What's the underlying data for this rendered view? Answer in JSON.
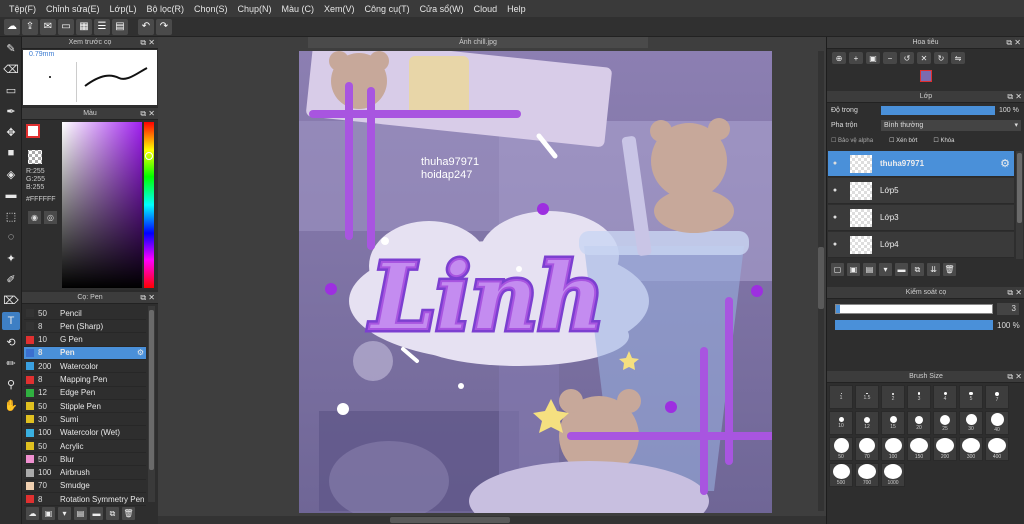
{
  "menu": [
    "Tệp(F)",
    "Chỉnh sửa(E)",
    "Lớp(L)",
    "Bộ lọc(R)",
    "Chọn(S)",
    "Chụp(N)",
    "Màu (C)",
    "Xem(V)",
    "Công cụ(T)",
    "Cửa sổ(W)",
    "Cloud",
    "Help"
  ],
  "brush_preview": {
    "title": "Xem trước cọ",
    "size": "0.79mm"
  },
  "color": {
    "title": "Màu",
    "r": "R:255",
    "g": "G:255",
    "b": "B:255",
    "hex": "#FFFFFF",
    "accent": "#a020f0"
  },
  "brush_panel": {
    "title": "Cọ: Pen",
    "items": [
      {
        "size": "50",
        "name": "Pencil",
        "color": "#333333"
      },
      {
        "size": "8",
        "name": "Pen (Sharp)",
        "color": "#333333"
      },
      {
        "size": "10",
        "name": "G Pen",
        "color": "#e03030"
      },
      {
        "size": "8",
        "name": "Pen",
        "color": "#3a6fd0"
      },
      {
        "size": "200",
        "name": "Watercolor",
        "color": "#3aa0e0"
      },
      {
        "size": "8",
        "name": "Mapping Pen",
        "color": "#e03030"
      },
      {
        "size": "12",
        "name": "Edge Pen",
        "color": "#30b040"
      },
      {
        "size": "50",
        "name": "Stipple Pen",
        "color": "#e0c020"
      },
      {
        "size": "30",
        "name": "Sumi",
        "color": "#e0c020"
      },
      {
        "size": "100",
        "name": "Watercolor (Wet)",
        "color": "#3ab0e0"
      },
      {
        "size": "50",
        "name": "Acrylic",
        "color": "#e0c020"
      },
      {
        "size": "50",
        "name": "Blur",
        "color": "#f090d0"
      },
      {
        "size": "100",
        "name": "Airbrush",
        "color": "#aaaaaa"
      },
      {
        "size": "70",
        "name": "Smudge",
        "color": "#f0d0b0"
      },
      {
        "size": "8",
        "name": "Rotation Symmetry Pen",
        "color": "#e03030"
      }
    ]
  },
  "document": {
    "tab": "Ảnh chill.jpg",
    "title_text": "Linh",
    "watermark_1": "thuha97971",
    "watermark_2": "hoidap247"
  },
  "navigator": {
    "title": "Hoa tiêu"
  },
  "layers": {
    "title": "Lớp",
    "opacity_label": "Độ trong",
    "opacity_value": "100 %",
    "blend_label": "Pha trộn",
    "blend_value": "Bình thường",
    "protect_alpha": "Bảo vệ alpha",
    "clipping": "Xén bớt",
    "lock": "Khóa",
    "items": [
      {
        "name": "thuha97971",
        "selected": true
      },
      {
        "name": "Lớp5",
        "selected": false
      },
      {
        "name": "Lớp3",
        "selected": false
      },
      {
        "name": "Lớp4",
        "selected": false
      }
    ]
  },
  "brush_control": {
    "title": "Kiểm soát cọ",
    "size_value": "3",
    "opacity_value": "100 %"
  },
  "brush_size": {
    "title": "Brush Size",
    "sizes": [
      "1",
      "1.5",
      "2",
      "3",
      "4",
      "5",
      "7",
      "10",
      "12",
      "15",
      "20",
      "25",
      "30",
      "40",
      "50",
      "70",
      "100",
      "150",
      "200",
      "300",
      "400",
      "500",
      "700",
      "1000"
    ]
  }
}
